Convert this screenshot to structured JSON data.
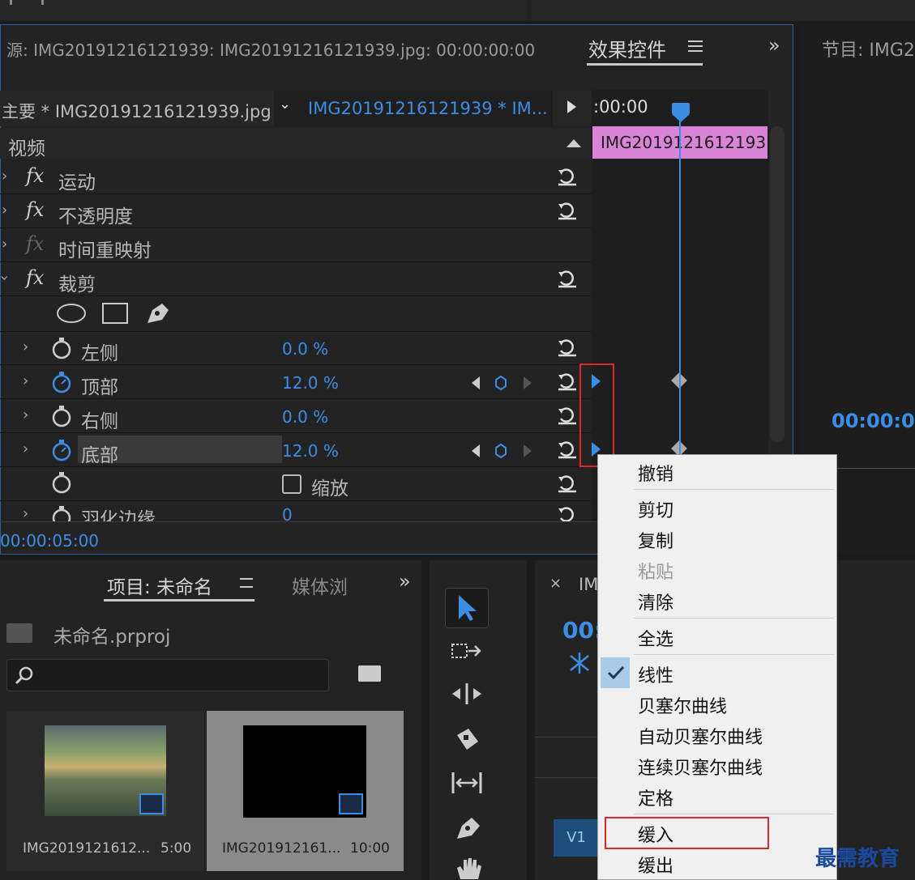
{
  "source_tab": {
    "label": "源: IMG20191216121939: IMG20191216121939.jpg: 00:00:00:00"
  },
  "effect_controls_tab": {
    "label": "效果控件"
  },
  "program_tab": {
    "label": "节目: IMG2"
  },
  "program_timecode": "00:00:0",
  "clip_header": {
    "master": "主要 * IMG20191216121939.jpg",
    "sequence": "IMG20191216121939 * IM..."
  },
  "timeline_ruler": ":00:00",
  "clip_bar_label": "IMG2019121612193",
  "video_section": "视频",
  "effects": [
    {
      "name": "运动"
    },
    {
      "name": "不透明度"
    },
    {
      "name": "时间重映射"
    },
    {
      "name": "裁剪"
    }
  ],
  "crop_params": [
    {
      "name": "左侧",
      "value": "0.0 %"
    },
    {
      "name": "顶部",
      "value": "12.0 %"
    },
    {
      "name": "右侧",
      "value": "0.0 %"
    },
    {
      "name": "底部",
      "value": "12.0 %"
    },
    {
      "name": "",
      "value": "缩放"
    },
    {
      "name": "羽化边缘",
      "value": "0"
    }
  ],
  "current_time": "00:00:05:00",
  "project_panel": {
    "tab": "项目: 未命名",
    "tab2": "媒体浏",
    "project_file": "未命名.prproj",
    "items": [
      {
        "name": "IMG2019121612...",
        "duration": "5:00"
      },
      {
        "name": "IMG201912161...",
        "duration": "10:00"
      }
    ]
  },
  "sequence_panel": {
    "tab_prefix": "IM",
    "timecode": "00:",
    "track": "V1"
  },
  "context_menu": {
    "groups": [
      [
        "撤销"
      ],
      [
        "剪切",
        "复制",
        "粘贴",
        "清除"
      ],
      [
        "全选"
      ],
      [
        "线性",
        "贝塞尔曲线",
        "自动贝塞尔曲线",
        "连续贝塞尔曲线",
        "定格"
      ],
      [
        "缓入",
        "缓出"
      ]
    ],
    "checked": "线性",
    "disabled": "粘贴",
    "highlighted_box": "缓入"
  },
  "watermark": "最需教育",
  "colors": {
    "accent": "#3a8ee6",
    "clip": "#da84d8",
    "highlight": "#e0252e"
  }
}
